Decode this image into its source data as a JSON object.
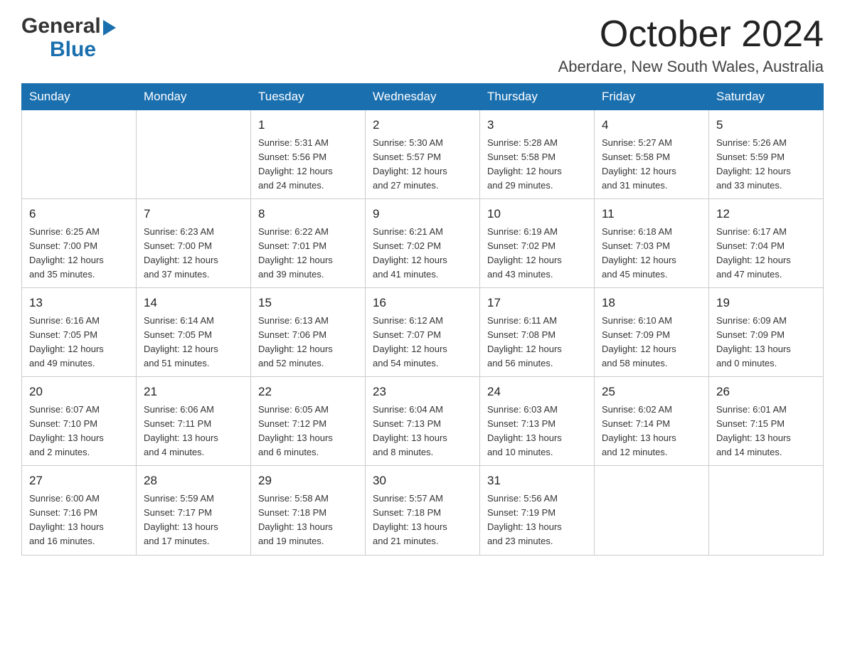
{
  "header": {
    "logo_general": "General",
    "logo_blue": "Blue",
    "month_title": "October 2024",
    "location": "Aberdare, New South Wales, Australia"
  },
  "calendar": {
    "days_of_week": [
      "Sunday",
      "Monday",
      "Tuesday",
      "Wednesday",
      "Thursday",
      "Friday",
      "Saturday"
    ],
    "weeks": [
      [
        {
          "day": "",
          "info": ""
        },
        {
          "day": "",
          "info": ""
        },
        {
          "day": "1",
          "info": "Sunrise: 5:31 AM\nSunset: 5:56 PM\nDaylight: 12 hours\nand 24 minutes."
        },
        {
          "day": "2",
          "info": "Sunrise: 5:30 AM\nSunset: 5:57 PM\nDaylight: 12 hours\nand 27 minutes."
        },
        {
          "day": "3",
          "info": "Sunrise: 5:28 AM\nSunset: 5:58 PM\nDaylight: 12 hours\nand 29 minutes."
        },
        {
          "day": "4",
          "info": "Sunrise: 5:27 AM\nSunset: 5:58 PM\nDaylight: 12 hours\nand 31 minutes."
        },
        {
          "day": "5",
          "info": "Sunrise: 5:26 AM\nSunset: 5:59 PM\nDaylight: 12 hours\nand 33 minutes."
        }
      ],
      [
        {
          "day": "6",
          "info": "Sunrise: 6:25 AM\nSunset: 7:00 PM\nDaylight: 12 hours\nand 35 minutes."
        },
        {
          "day": "7",
          "info": "Sunrise: 6:23 AM\nSunset: 7:00 PM\nDaylight: 12 hours\nand 37 minutes."
        },
        {
          "day": "8",
          "info": "Sunrise: 6:22 AM\nSunset: 7:01 PM\nDaylight: 12 hours\nand 39 minutes."
        },
        {
          "day": "9",
          "info": "Sunrise: 6:21 AM\nSunset: 7:02 PM\nDaylight: 12 hours\nand 41 minutes."
        },
        {
          "day": "10",
          "info": "Sunrise: 6:19 AM\nSunset: 7:02 PM\nDaylight: 12 hours\nand 43 minutes."
        },
        {
          "day": "11",
          "info": "Sunrise: 6:18 AM\nSunset: 7:03 PM\nDaylight: 12 hours\nand 45 minutes."
        },
        {
          "day": "12",
          "info": "Sunrise: 6:17 AM\nSunset: 7:04 PM\nDaylight: 12 hours\nand 47 minutes."
        }
      ],
      [
        {
          "day": "13",
          "info": "Sunrise: 6:16 AM\nSunset: 7:05 PM\nDaylight: 12 hours\nand 49 minutes."
        },
        {
          "day": "14",
          "info": "Sunrise: 6:14 AM\nSunset: 7:05 PM\nDaylight: 12 hours\nand 51 minutes."
        },
        {
          "day": "15",
          "info": "Sunrise: 6:13 AM\nSunset: 7:06 PM\nDaylight: 12 hours\nand 52 minutes."
        },
        {
          "day": "16",
          "info": "Sunrise: 6:12 AM\nSunset: 7:07 PM\nDaylight: 12 hours\nand 54 minutes."
        },
        {
          "day": "17",
          "info": "Sunrise: 6:11 AM\nSunset: 7:08 PM\nDaylight: 12 hours\nand 56 minutes."
        },
        {
          "day": "18",
          "info": "Sunrise: 6:10 AM\nSunset: 7:09 PM\nDaylight: 12 hours\nand 58 minutes."
        },
        {
          "day": "19",
          "info": "Sunrise: 6:09 AM\nSunset: 7:09 PM\nDaylight: 13 hours\nand 0 minutes."
        }
      ],
      [
        {
          "day": "20",
          "info": "Sunrise: 6:07 AM\nSunset: 7:10 PM\nDaylight: 13 hours\nand 2 minutes."
        },
        {
          "day": "21",
          "info": "Sunrise: 6:06 AM\nSunset: 7:11 PM\nDaylight: 13 hours\nand 4 minutes."
        },
        {
          "day": "22",
          "info": "Sunrise: 6:05 AM\nSunset: 7:12 PM\nDaylight: 13 hours\nand 6 minutes."
        },
        {
          "day": "23",
          "info": "Sunrise: 6:04 AM\nSunset: 7:13 PM\nDaylight: 13 hours\nand 8 minutes."
        },
        {
          "day": "24",
          "info": "Sunrise: 6:03 AM\nSunset: 7:13 PM\nDaylight: 13 hours\nand 10 minutes."
        },
        {
          "day": "25",
          "info": "Sunrise: 6:02 AM\nSunset: 7:14 PM\nDaylight: 13 hours\nand 12 minutes."
        },
        {
          "day": "26",
          "info": "Sunrise: 6:01 AM\nSunset: 7:15 PM\nDaylight: 13 hours\nand 14 minutes."
        }
      ],
      [
        {
          "day": "27",
          "info": "Sunrise: 6:00 AM\nSunset: 7:16 PM\nDaylight: 13 hours\nand 16 minutes."
        },
        {
          "day": "28",
          "info": "Sunrise: 5:59 AM\nSunset: 7:17 PM\nDaylight: 13 hours\nand 17 minutes."
        },
        {
          "day": "29",
          "info": "Sunrise: 5:58 AM\nSunset: 7:18 PM\nDaylight: 13 hours\nand 19 minutes."
        },
        {
          "day": "30",
          "info": "Sunrise: 5:57 AM\nSunset: 7:18 PM\nDaylight: 13 hours\nand 21 minutes."
        },
        {
          "day": "31",
          "info": "Sunrise: 5:56 AM\nSunset: 7:19 PM\nDaylight: 13 hours\nand 23 minutes."
        },
        {
          "day": "",
          "info": ""
        },
        {
          "day": "",
          "info": ""
        }
      ]
    ]
  }
}
